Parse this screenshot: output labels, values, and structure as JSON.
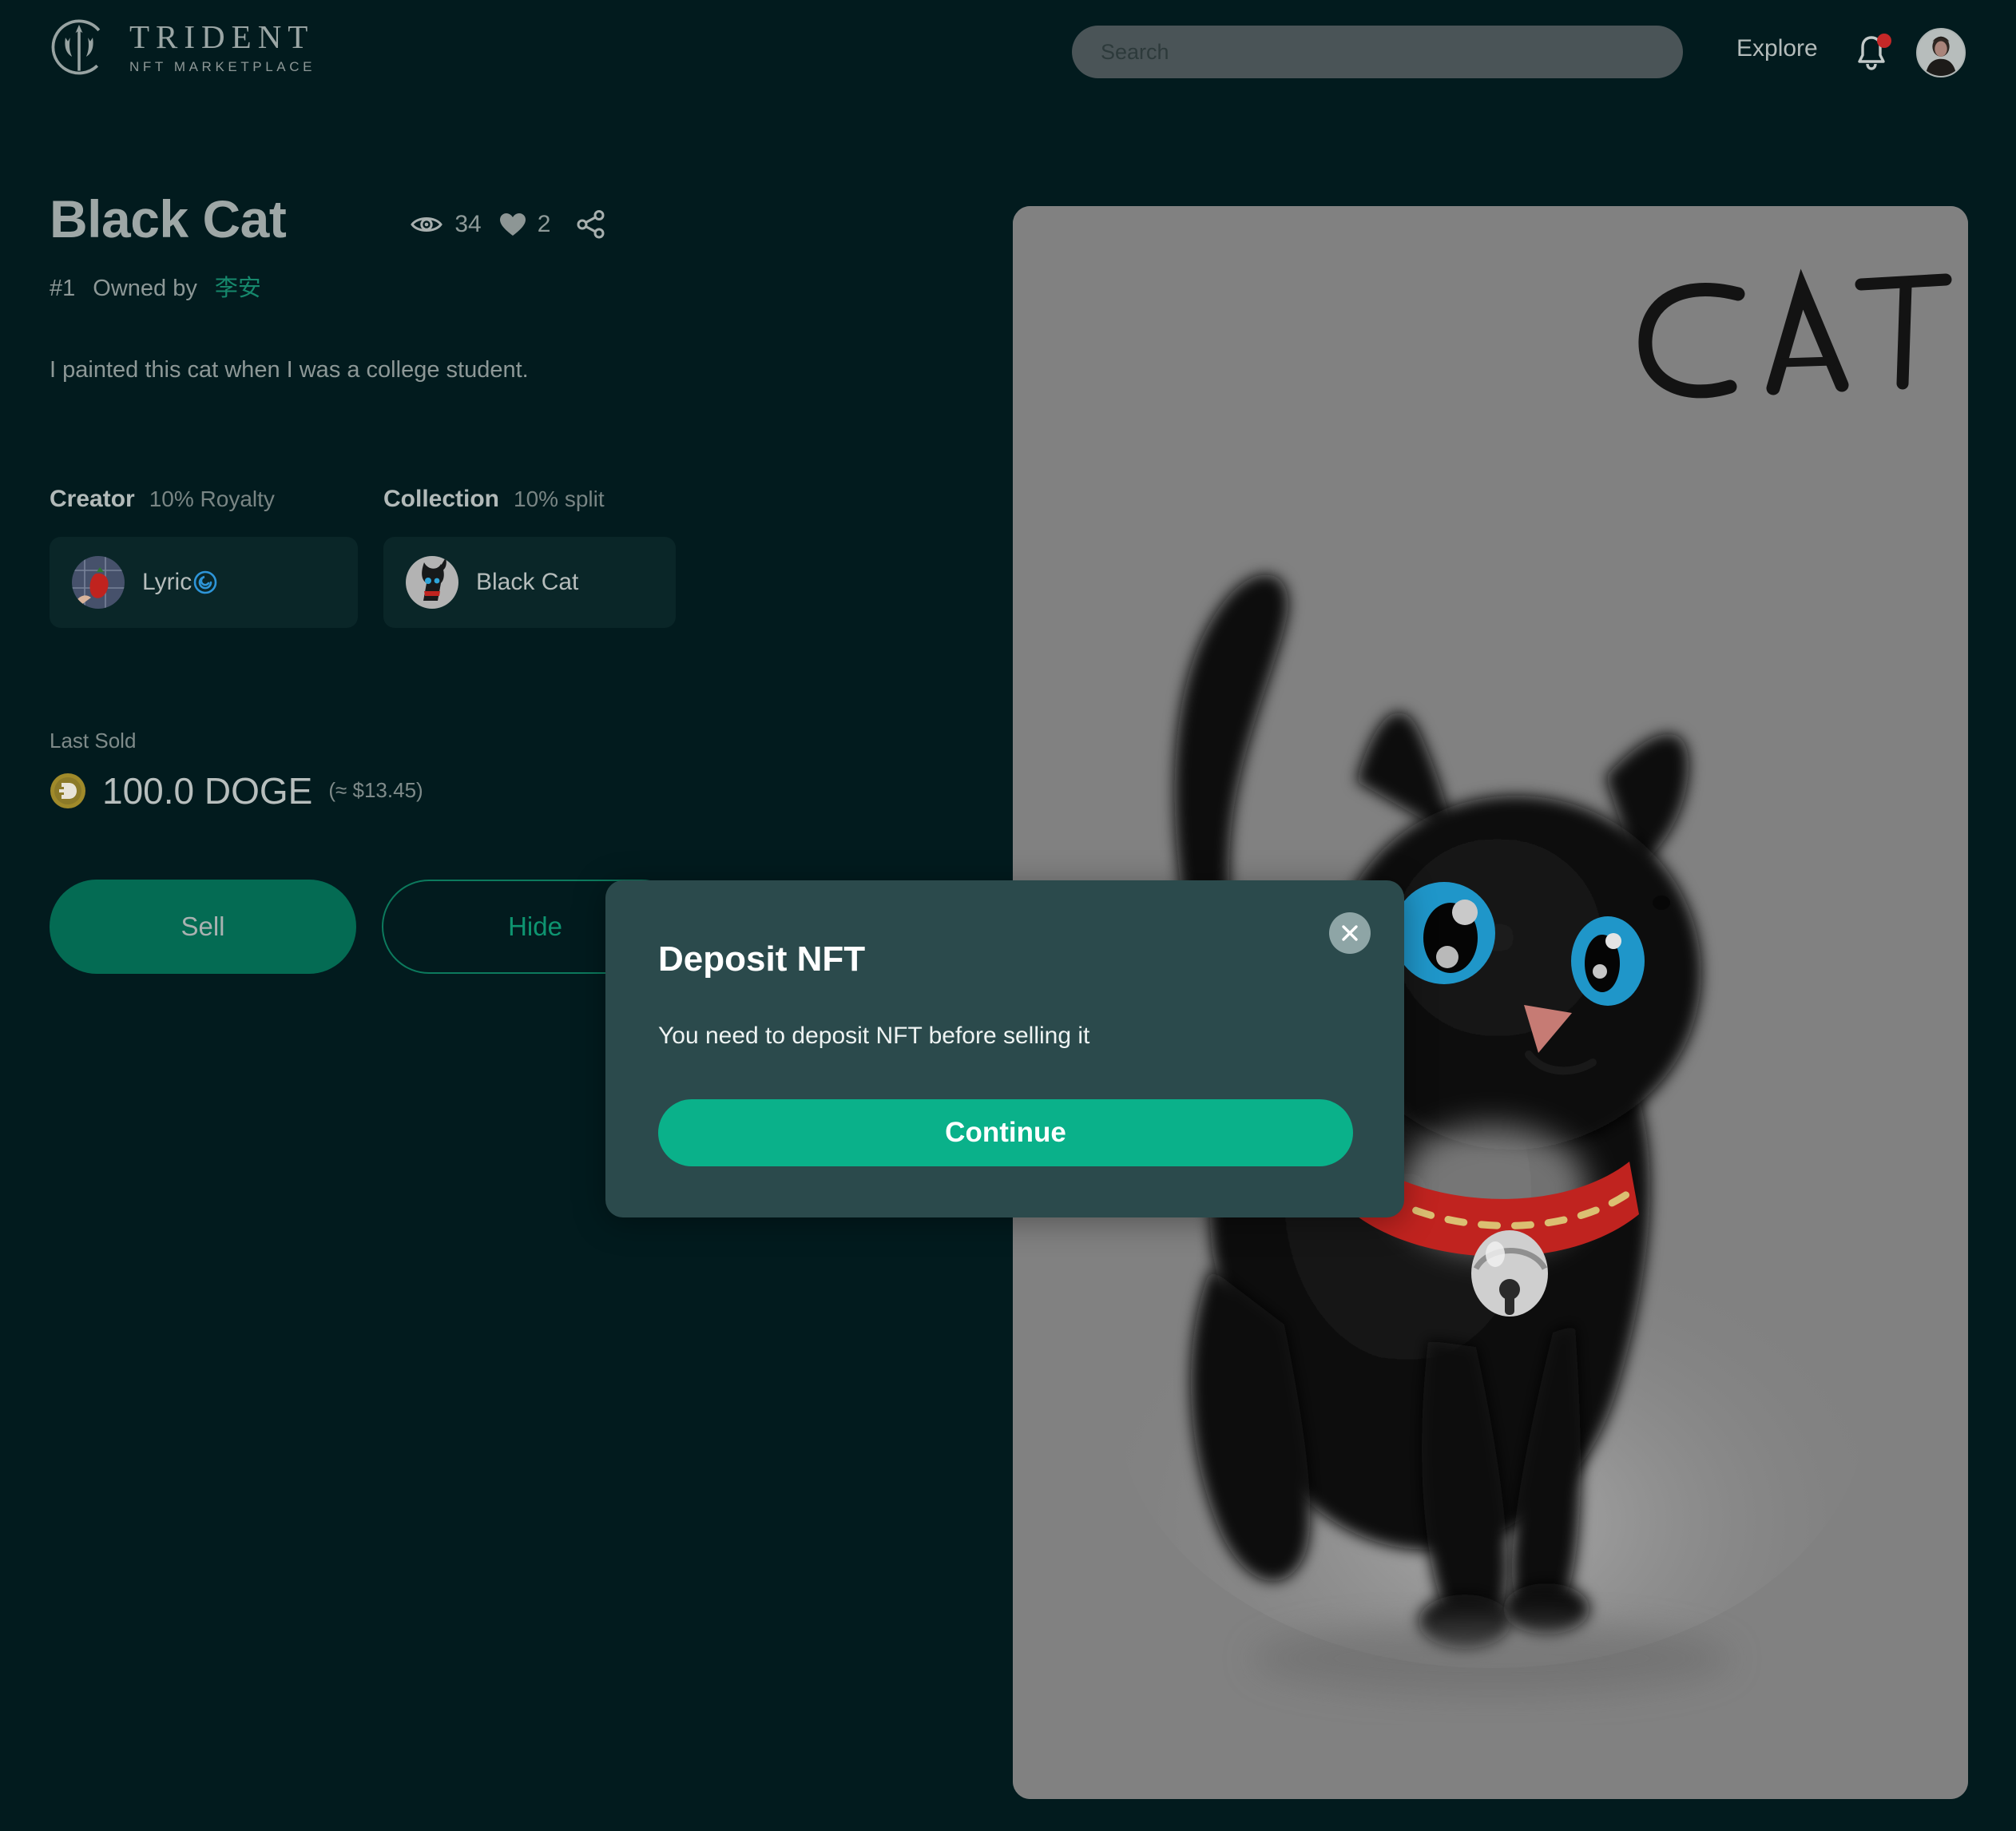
{
  "header": {
    "brand_title": "TRIDENT",
    "brand_subtitle": "NFT MARKETPLACE",
    "brand_icon": "trident-logo-icon",
    "search_placeholder": "Search",
    "search_value": "",
    "explore_label": "Explore",
    "bell_icon": "notification-bell-icon",
    "has_notification": true,
    "avatar_icon": "user-avatar"
  },
  "nft": {
    "title": "Black Cat",
    "edition": "#1",
    "owned_by_label": "Owned by",
    "owner_name": "李安",
    "description": "I painted this cat when I was a college student.",
    "stats": {
      "views_icon": "eye-icon",
      "views": "34",
      "likes_icon": "heart-icon",
      "likes": "2",
      "share_icon": "share-icon"
    },
    "creator": {
      "label": "Creator",
      "sub": "10% Royalty",
      "name": "Lyric",
      "verified_icon": "verified-badge-icon",
      "avatar_icon": "creator-avatar"
    },
    "collection": {
      "label": "Collection",
      "sub": "10% split",
      "name": "Black Cat",
      "avatar_icon": "collection-avatar"
    },
    "last_sold": {
      "label": "Last Sold",
      "coin_icon": "dogecoin-icon",
      "amount": "100.0 DOGE",
      "usd": "(≈ $13.45)"
    },
    "artwork": {
      "caption_text": "CAT",
      "alt": "black cat with blue eyes and red collar"
    }
  },
  "actions": {
    "sell_label": "Sell",
    "hide_label": "Hide"
  },
  "modal": {
    "title": "Deposit NFT",
    "body": "You need to deposit NFT before selling it",
    "continue_label": "Continue",
    "close_icon": "close-icon"
  },
  "colors": {
    "page_bg": "#021b1e",
    "accent_teal": "#0ab18a",
    "primary_button": "#046b53",
    "owner_link": "#16886c",
    "modal_bg": "#2b4a4c",
    "search_bg": "#4a5457",
    "notification_dot": "#c62828",
    "art_bg": "#818181"
  }
}
